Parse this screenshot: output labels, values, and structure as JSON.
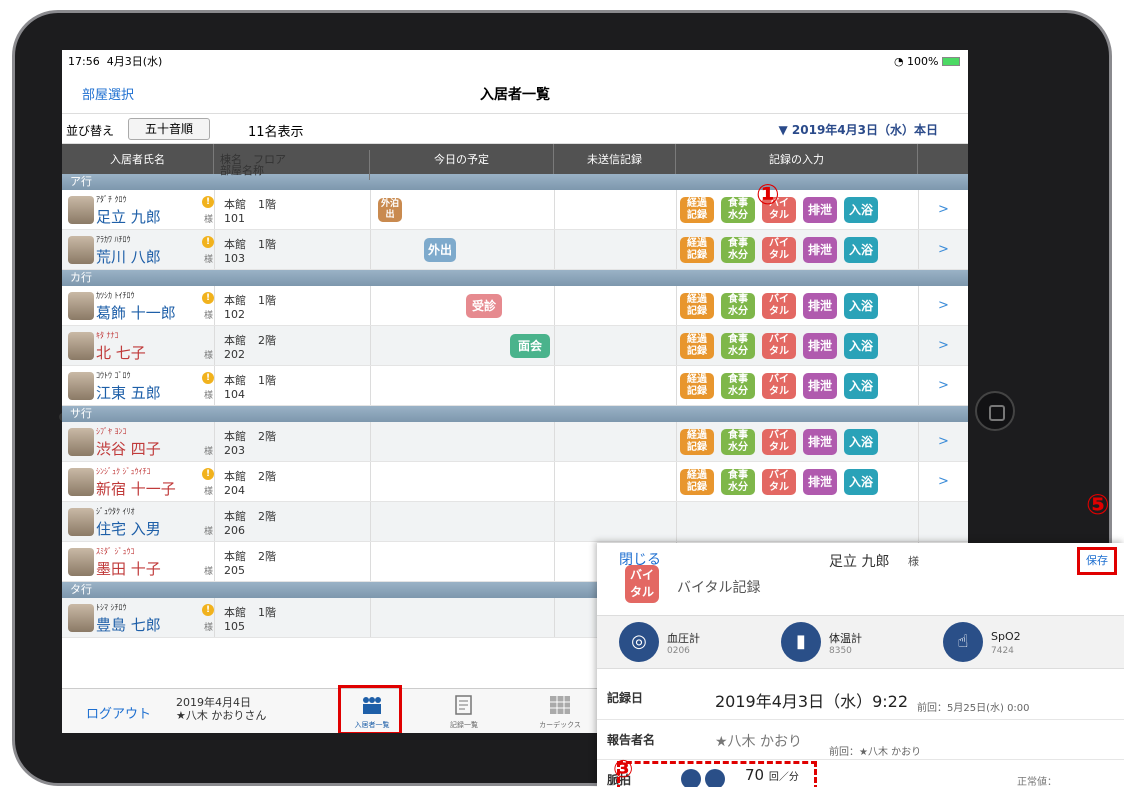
{
  "status": {
    "time": "17:56",
    "date": "4月3日(水)",
    "battery": "100%"
  },
  "nav": {
    "left": "部屋選択",
    "title": "入居者一覧"
  },
  "sort": {
    "label": "並び替え",
    "button": "五十音順",
    "count": "11名表示",
    "date_selector": "▼ 2019年4月3日（水）本日"
  },
  "columns": {
    "name": "入居者氏名",
    "floor_top": "棟名　フロア",
    "floor_bottom": "部屋名称",
    "schedule": "今日の予定",
    "unsent": "未送信記録",
    "input": "記録の入力"
  },
  "actions": {
    "keika": "経過記録",
    "shokuji": "食事水分",
    "vital": "バイタル",
    "haisetsu": "排泄",
    "nyuyoku": "入浴",
    "chevron": ">"
  },
  "groups": [
    {
      "label": "ア行",
      "rows": [
        {
          "kana": "ｱﾀﾞﾁ ｸﾛｳ",
          "name": "足立 九郎",
          "alert": true,
          "sama": "様",
          "building": "本館",
          "floor": "1階",
          "room": "101",
          "event": "外泊出",
          "event_color": "#c98a4f",
          "actions": true,
          "female": false
        },
        {
          "kana": "ｱﾗｶﾜ ﾊﾁﾛｳ",
          "name": "荒川 八郎",
          "alert": true,
          "sama": "様",
          "building": "本館",
          "floor": "1階",
          "room": "103",
          "event": "外出",
          "event_color": "#7eaacc",
          "actions": true,
          "female": false
        }
      ]
    },
    {
      "label": "カ行",
      "rows": [
        {
          "kana": "ｶﾂｼｶ ﾄｲﾁﾛｳ",
          "name": "葛飾 十一郎",
          "alert": true,
          "sama": "様",
          "building": "本館",
          "floor": "1階",
          "room": "102",
          "event": "受診",
          "event_color": "#e68a8f",
          "actions": true,
          "female": false
        },
        {
          "kana": "ｷﾀ ﾅﾅｺ",
          "name": "北 七子",
          "alert": false,
          "sama": "様",
          "building": "本館",
          "floor": "2階",
          "room": "202",
          "event": "面会",
          "event_color": "#4ab38c",
          "actions": true,
          "female": true
        },
        {
          "kana": "ｺｳﾄｳ ｺﾞﾛｳ",
          "name": "江東 五郎",
          "alert": true,
          "sama": "様",
          "building": "本館",
          "floor": "1階",
          "room": "104",
          "event": "",
          "event_color": "",
          "actions": true,
          "female": false
        }
      ]
    },
    {
      "label": "サ行",
      "rows": [
        {
          "kana": "ｼﾌﾞﾔ ﾖﾝｺ",
          "name": "渋谷 四子",
          "alert": false,
          "sama": "様",
          "building": "本館",
          "floor": "2階",
          "room": "203",
          "event": "",
          "event_color": "",
          "actions": true,
          "female": true
        },
        {
          "kana": "ｼﾝｼﾞｭｸ ｼﾞｭｳｲﾁｺ",
          "name": "新宿 十一子",
          "alert": true,
          "sama": "様",
          "building": "本館",
          "floor": "2階",
          "room": "204",
          "event": "",
          "event_color": "",
          "actions": true,
          "female": true
        },
        {
          "kana": "ｼﾞｭｳﾀｸ ｲﾘｵ",
          "name": "住宅 入男",
          "alert": false,
          "sama": "様",
          "building": "本館",
          "floor": "2階",
          "room": "206",
          "event": "",
          "event_color": "",
          "actions": false,
          "female": false
        },
        {
          "kana": "ｽﾐﾀﾞ ｼﾞｭｳｺ",
          "name": "墨田 十子",
          "alert": false,
          "sama": "様",
          "building": "本館",
          "floor": "2階",
          "room": "205",
          "event": "",
          "event_color": "",
          "actions": false,
          "female": true
        }
      ]
    },
    {
      "label": "タ行",
      "rows": [
        {
          "kana": "ﾄｼﾏ ｼﾁﾛｳ",
          "name": "豊島 七郎",
          "alert": true,
          "sama": "様",
          "building": "本館",
          "floor": "1階",
          "room": "105",
          "event": "",
          "event_color": "",
          "actions": false,
          "female": false
        }
      ]
    }
  ],
  "tabbar": {
    "logout": "ログアウト",
    "date": "2019年4月4日",
    "user": "★八木 かおりさん",
    "tabs": [
      "入居者一覧",
      "記録一覧",
      "カーデックス"
    ]
  },
  "popup": {
    "close": "閉じる",
    "name": "足立 九郎",
    "sama": "様",
    "save": "保存",
    "badge": "バイタル",
    "title": "バイタル記録",
    "devices": [
      {
        "name": "血圧計",
        "num": "0206"
      },
      {
        "name": "体温計",
        "num": "8350"
      },
      {
        "name": "SpO2",
        "num": "7424"
      }
    ],
    "record_date_label": "記録日",
    "record_date": "2019年4月3日（水）9:22",
    "prev_date": "前回：5月25日(水) 0:00",
    "reporter_label": "報告者名",
    "reporter": "★八木 かおり",
    "prev_reporter": "前回：★八木 かおり",
    "pulse_label": "脈拍",
    "pulse": "70",
    "pulse_unit": "回／分",
    "normal": "正常値："
  },
  "markers": {
    "m1": "①",
    "m3": "③",
    "m5": "⑤"
  },
  "colors": {
    "keika": "#e8962e",
    "shokuji": "#7fb74a",
    "vital": "#e36863",
    "haisetsu": "#b05aae",
    "nyuyoku": "#2aa2b8",
    "header": "#525252",
    "accent": "#1e6fd0",
    "marker": "#e00000"
  }
}
